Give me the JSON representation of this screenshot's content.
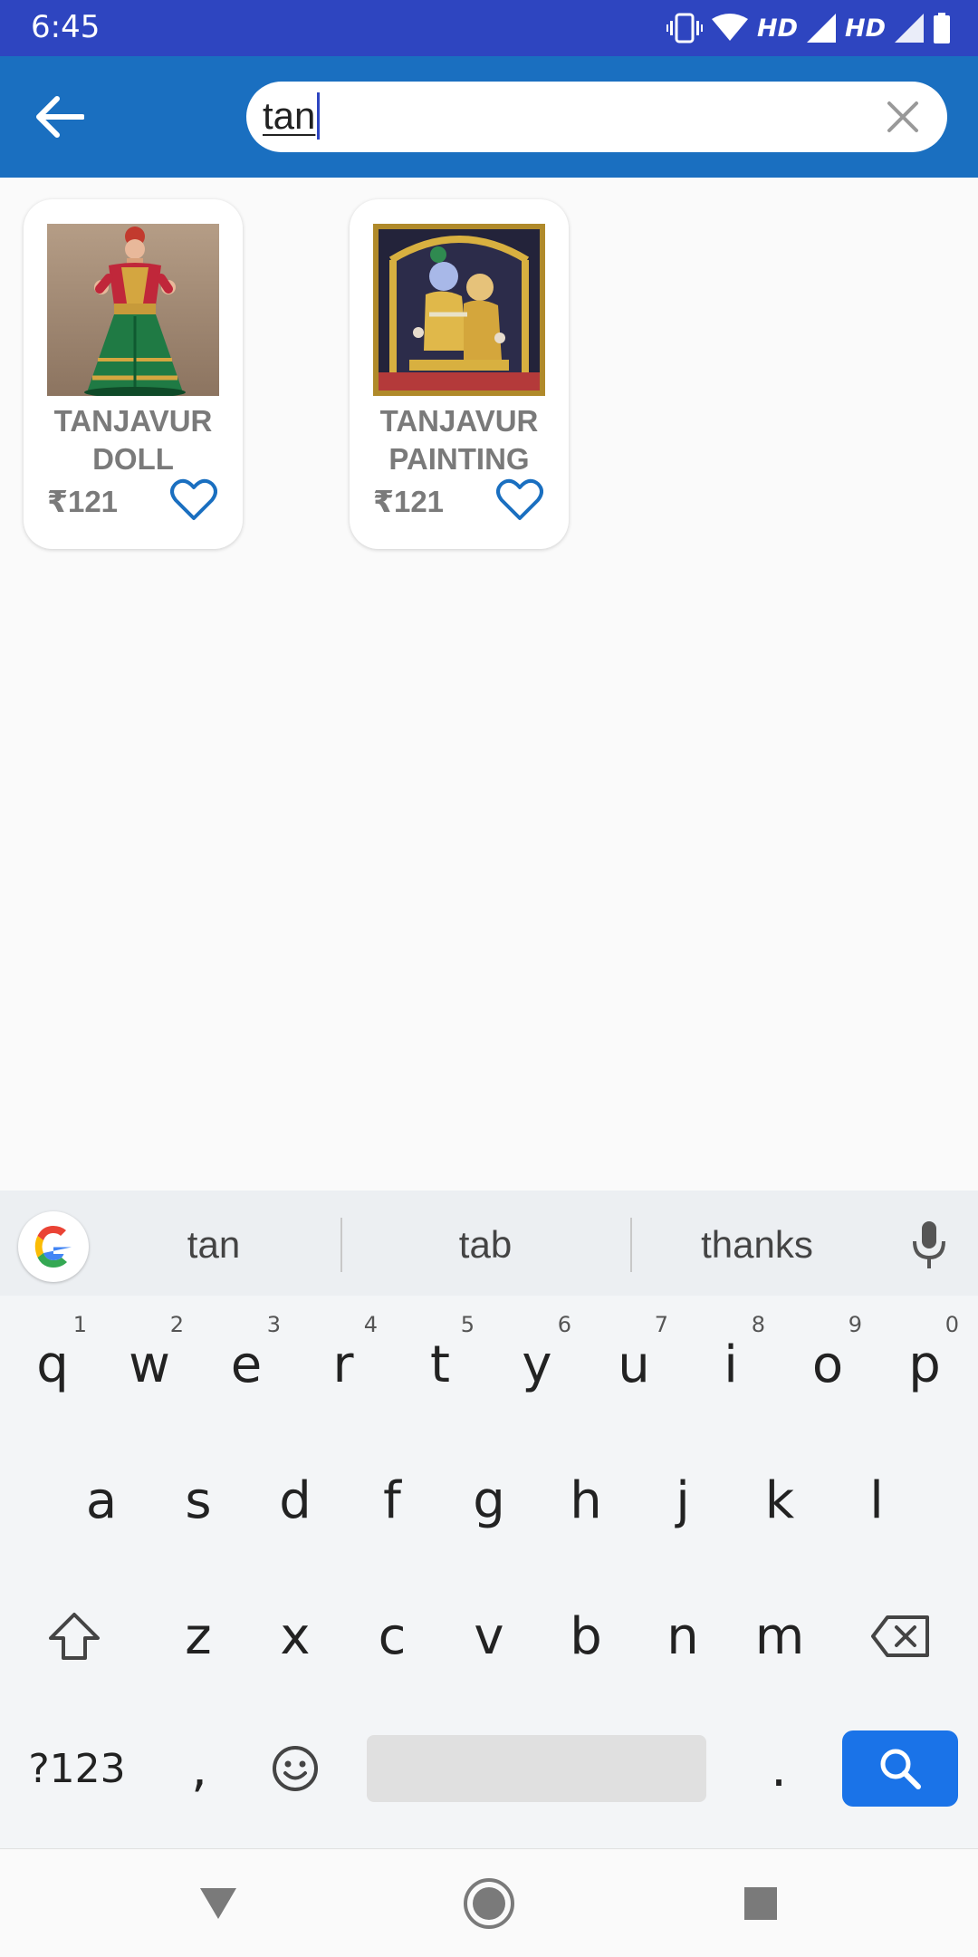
{
  "status_bar": {
    "time": "6:45",
    "network_label_1": "HD",
    "network_label_2": "HD"
  },
  "app_bar": {
    "search_value": "tan"
  },
  "products": [
    {
      "name_line1": "TANJAVUR",
      "name_line2": "DOLL",
      "price": "₹121"
    },
    {
      "name_line1": "TANJAVUR",
      "name_line2": "PAINTING",
      "price": "₹121"
    }
  ],
  "keyboard": {
    "suggestions": [
      "tan",
      "tab",
      "thanks"
    ],
    "row1": [
      {
        "key": "q",
        "hint": "1"
      },
      {
        "key": "w",
        "hint": "2"
      },
      {
        "key": "e",
        "hint": "3"
      },
      {
        "key": "r",
        "hint": "4"
      },
      {
        "key": "t",
        "hint": "5"
      },
      {
        "key": "y",
        "hint": "6"
      },
      {
        "key": "u",
        "hint": "7"
      },
      {
        "key": "i",
        "hint": "8"
      },
      {
        "key": "o",
        "hint": "9"
      },
      {
        "key": "p",
        "hint": "0"
      }
    ],
    "row2": [
      "a",
      "s",
      "d",
      "f",
      "g",
      "h",
      "j",
      "k",
      "l"
    ],
    "row3": [
      "z",
      "x",
      "c",
      "v",
      "b",
      "n",
      "m"
    ],
    "symbols_label": "?123",
    "comma_label": ",",
    "period_label": "."
  },
  "colors": {
    "status_bar": "#2e45c0",
    "app_bar": "#1a6fc0",
    "accent": "#1a73e8"
  }
}
